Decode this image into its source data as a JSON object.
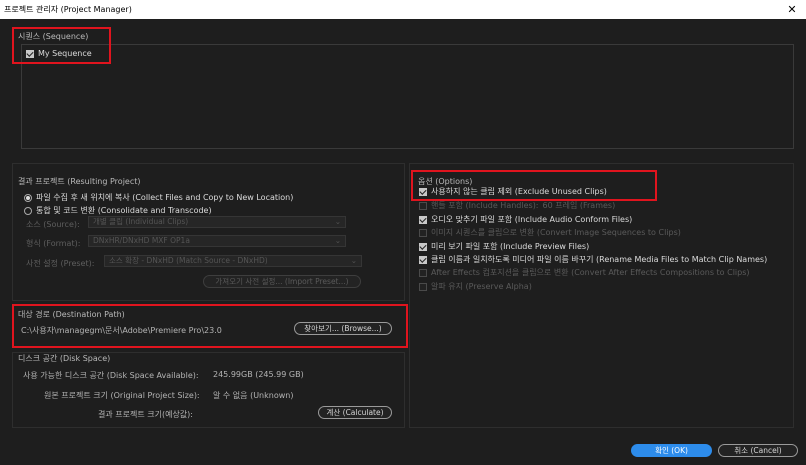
{
  "window": {
    "title": "프로젝트 관리자 (Project Manager)",
    "close_glyph": "✕"
  },
  "sequence": {
    "label": "시퀀스 (Sequence)",
    "item": {
      "label": "My Sequence",
      "checked": true
    }
  },
  "resulting_project": {
    "label": "결과 프로젝트 (Resulting Project)",
    "collect_radio": "파일 수집 후 새 위치에 복사 (Collect Files and Copy to New Location)",
    "consolidate_radio": "통합 및 코드 변환 (Consolidate and Transcode)",
    "source_label": "소스 (Source):",
    "source_value": "개별 클립 (Individual Clips)",
    "format_label": "형식 (Format):",
    "format_value": "DNxHR/DNxHD MXF OP1a",
    "preset_label": "사전 설정 (Preset):",
    "preset_value": "소스 확장 - DNxHD (Match Source - DNxHD)",
    "import_preset_button": "가져오기 사전 설정... (Import Preset...)"
  },
  "destination": {
    "label": "대상 경로 (Destination Path)",
    "path": "C:\\사용자\\managegm\\문서\\Adobe\\Premiere Pro\\23.0",
    "browse_button": "찾아보기... (Browse...)"
  },
  "disk_space": {
    "label": "디스크 공간 (Disk Space)",
    "available_label": "사용 가능한 디스크 공간 (Disk Space Available):",
    "available_value": "245.99GB (245.99 GB)",
    "original_label": "원본 프로젝트 크기 (Original Project Size):",
    "original_value": "알 수 없음 (Unknown)",
    "resulting_label": "결과 프로젝트 크기(예상값):",
    "calculate_button": "계산 (Calculate)"
  },
  "options": {
    "label": "옵션 (Options)",
    "items": [
      {
        "label": "사용하지 않는 클립 제외 (Exclude Unused Clips)",
        "checked": true,
        "enabled": true
      },
      {
        "label": "핸들 포함 (Include Handles):",
        "suffix": "60 프레임 (Frames)",
        "checked": false,
        "enabled": false
      },
      {
        "label": "오디오 맞추기 파일 포함 (Include Audio Conform Files)",
        "checked": true,
        "enabled": true
      },
      {
        "label": "이미지 시퀀스를 클립으로 변환 (Convert Image Sequences to Clips)",
        "checked": false,
        "enabled": false
      },
      {
        "label": "미리 보기 파일 포함 (Include Preview Files)",
        "checked": true,
        "enabled": true
      },
      {
        "label": "클립 이름과 일치하도록 미디어 파일 이름 바꾸기 (Rename Media Files to Match Clip Names)",
        "checked": true,
        "enabled": true
      },
      {
        "label": "After Effects 컴포지션을 클립으로 변환 (Convert After Effects Compositions to Clips)",
        "checked": false,
        "enabled": false
      },
      {
        "label": "알파 유지 (Preserve Alpha)",
        "checked": false,
        "enabled": false
      }
    ]
  },
  "footer": {
    "ok_button": "확인 (OK)",
    "cancel_button": "취소 (Cancel)"
  },
  "colors": {
    "accent": "#2d8ceb",
    "highlight": "#e0141e",
    "background": "#1e1e1e"
  }
}
